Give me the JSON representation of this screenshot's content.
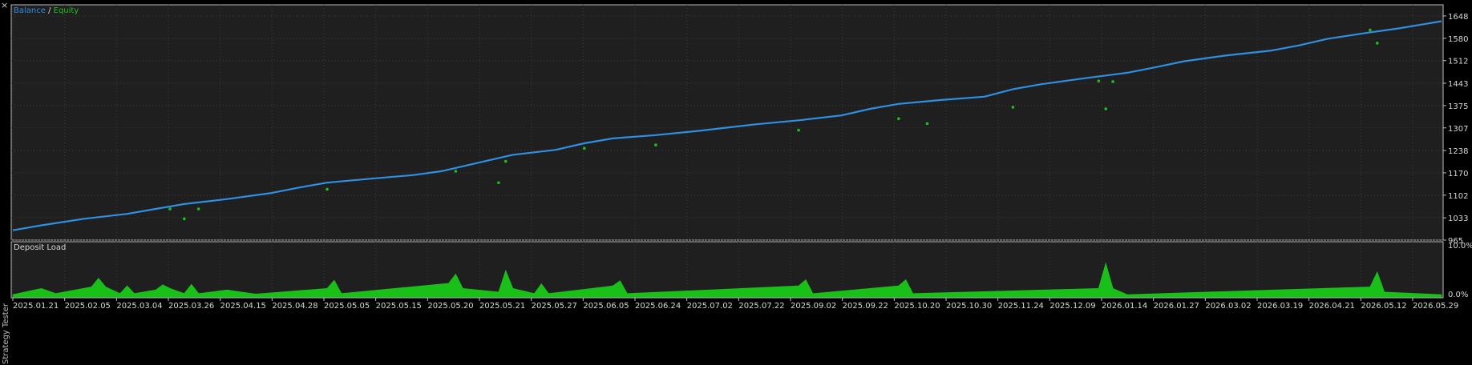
{
  "window": {
    "side_label": "Strategy Tester",
    "close_glyph": "×"
  },
  "colors": {
    "background": "#000000",
    "plot_background": "#1f1f1f",
    "grid": "#3c3c3c",
    "balance": "#2f8fe0",
    "equity": "#19c219",
    "deposit_load": "#18c018",
    "text": "#d8d8d8"
  },
  "chart_data": [
    {
      "type": "line",
      "legend": {
        "items": [
          "Balance",
          "Equity"
        ],
        "separator": " / ",
        "placement": "top-left"
      },
      "x_ticks": [
        "2025.01.21",
        "2025.02.05",
        "2025.03.04",
        "2025.03.26",
        "2025.04.15",
        "2025.04.28",
        "2025.05.05",
        "2025.05.15",
        "2025.05.20",
        "2025.05.21",
        "2025.05.27",
        "2025.06.05",
        "2025.06.24",
        "2025.07.02",
        "2025.07.22",
        "2025.09.02",
        "2025.09.22",
        "2025.10.20",
        "2025.10.30",
        "2025.11.24",
        "2025.12.09",
        "2026.01.14",
        "2026.01.27",
        "2026.03.02",
        "2026.03.19",
        "2026.04.21",
        "2026.05.12",
        "2026.05.29"
      ],
      "y_ticks": [
        "1648",
        "1580",
        "1512",
        "1443",
        "1375",
        "1307",
        "1238",
        "1170",
        "1102",
        "1033",
        "965"
      ],
      "ylim": [
        965,
        1682
      ],
      "grid": true,
      "series": [
        {
          "name": "Balance",
          "x": [
            0,
            0.02,
            0.05,
            0.08,
            0.1,
            0.12,
            0.15,
            0.18,
            0.2,
            0.22,
            0.25,
            0.28,
            0.3,
            0.33,
            0.35,
            0.38,
            0.4,
            0.42,
            0.45,
            0.48,
            0.5,
            0.52,
            0.55,
            0.58,
            0.6,
            0.62,
            0.65,
            0.68,
            0.7,
            0.72,
            0.75,
            0.78,
            0.8,
            0.82,
            0.85,
            0.88,
            0.9,
            0.92,
            0.95,
            0.97,
            1
          ],
          "values": [
            995,
            1010,
            1030,
            1045,
            1060,
            1075,
            1090,
            1108,
            1125,
            1140,
            1152,
            1163,
            1175,
            1205,
            1225,
            1240,
            1260,
            1275,
            1285,
            1298,
            1308,
            1318,
            1330,
            1345,
            1365,
            1380,
            1392,
            1402,
            1425,
            1440,
            1458,
            1475,
            1492,
            1510,
            1528,
            1542,
            1558,
            1578,
            1598,
            1610,
            1632
          ]
        },
        {
          "name": "Equity",
          "x": [
            0.11,
            0.12,
            0.13,
            0.22,
            0.31,
            0.34,
            0.345,
            0.4,
            0.45,
            0.55,
            0.62,
            0.64,
            0.7,
            0.76,
            0.765,
            0.77,
            0.95,
            0.955
          ],
          "values": [
            1060,
            1030,
            1060,
            1120,
            1175,
            1140,
            1205,
            1245,
            1255,
            1300,
            1335,
            1320,
            1370,
            1450,
            1365,
            1448,
            1605,
            1565
          ]
        }
      ]
    },
    {
      "type": "area",
      "title": "Deposit Load",
      "ylim": [
        0,
        10
      ],
      "y_ticks": [
        "10.0%",
        "0.0%"
      ],
      "grid": true,
      "series": [
        {
          "name": "Deposit Load",
          "x": [
            0,
            0.02,
            0.03,
            0.055,
            0.06,
            0.065,
            0.075,
            0.08,
            0.085,
            0.1,
            0.105,
            0.11,
            0.12,
            0.125,
            0.13,
            0.15,
            0.16,
            0.17,
            0.22,
            0.225,
            0.23,
            0.305,
            0.31,
            0.315,
            0.34,
            0.345,
            0.35,
            0.365,
            0.37,
            0.375,
            0.42,
            0.425,
            0.43,
            0.55,
            0.555,
            0.56,
            0.62,
            0.625,
            0.63,
            0.76,
            0.765,
            0.77,
            0.78,
            0.95,
            0.955,
            0.96,
            1
          ],
          "values": [
            0.3,
            1.5,
            0.5,
            1.8,
            3.5,
            1.8,
            0.5,
            2.0,
            0.5,
            1.2,
            2.2,
            1.5,
            0.5,
            2.3,
            0.5,
            1.2,
            0.8,
            0.4,
            1.5,
            3.1,
            0.5,
            2.5,
            4.3,
            1.5,
            0.8,
            5.0,
            1.5,
            0.5,
            2.4,
            0.5,
            2.0,
            3.0,
            0.5,
            2.0,
            3.2,
            0.5,
            2.0,
            3.2,
            0.5,
            1.5,
            6.4,
            1.5,
            0.3,
            1.8,
            4.7,
            0.8,
            0.3
          ]
        }
      ]
    }
  ]
}
